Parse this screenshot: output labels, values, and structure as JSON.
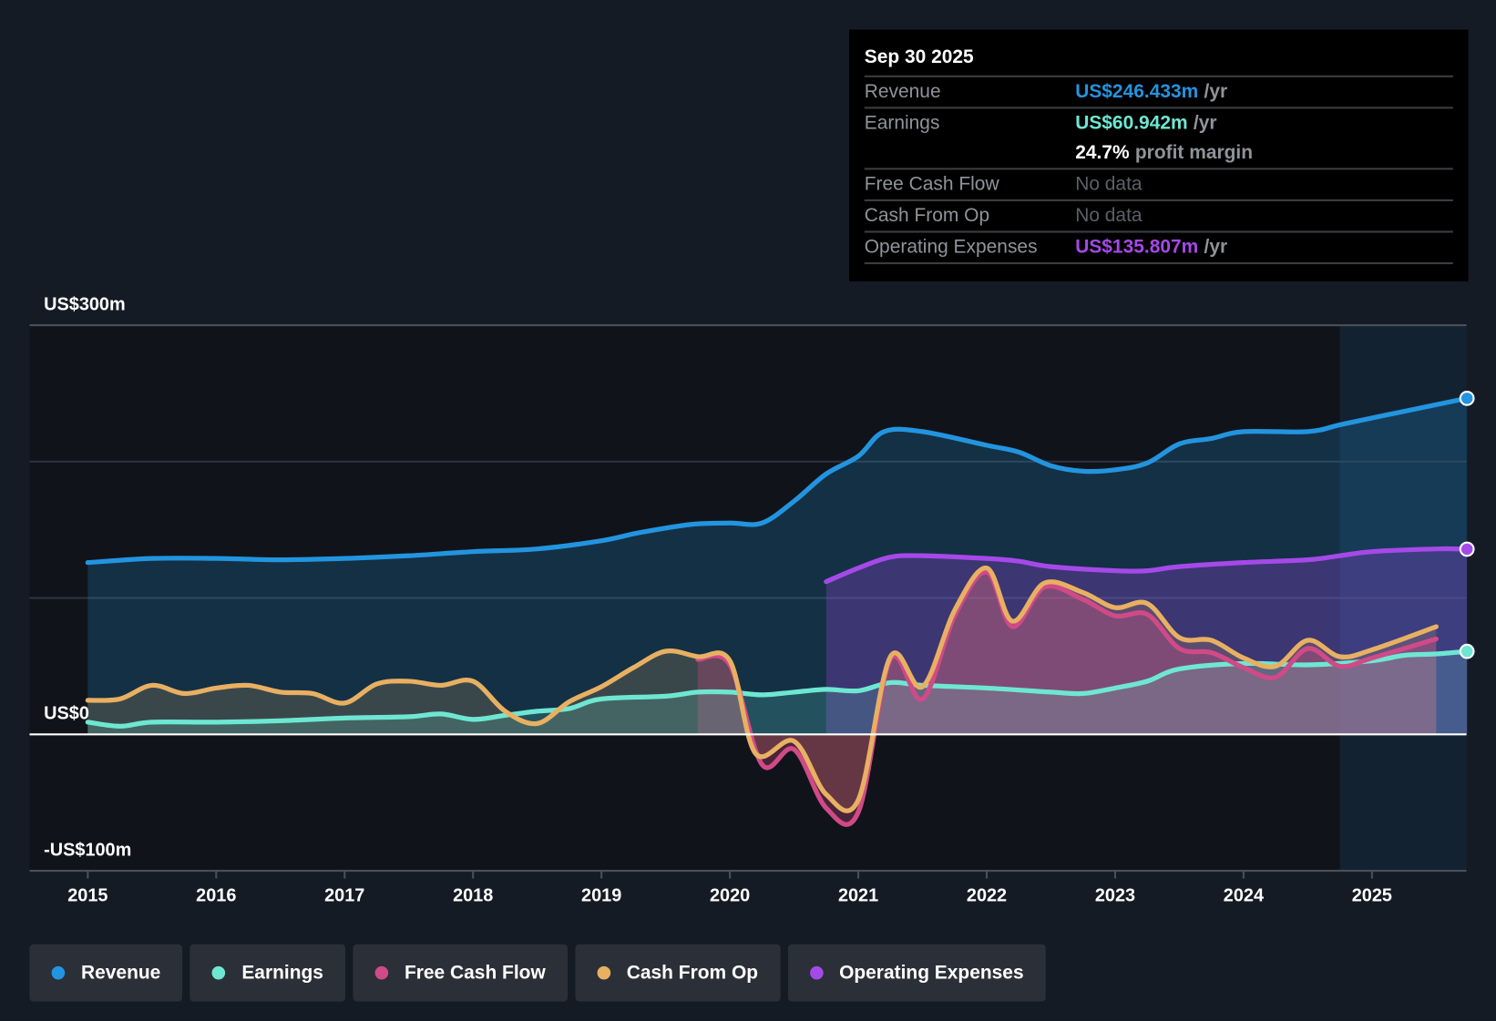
{
  "tooltip": {
    "date": "Sep 30 2025",
    "rows": [
      {
        "label": "Revenue",
        "value": "US$246.433m",
        "unit": "/yr"
      },
      {
        "label": "Earnings",
        "value": "US$60.942m",
        "unit": "/yr"
      },
      {
        "label": "",
        "value": "24.7%",
        "unit": "profit margin"
      },
      {
        "label": "Free Cash Flow",
        "value": "No data"
      },
      {
        "label": "Cash From Op",
        "value": "No data"
      },
      {
        "label": "Operating Expenses",
        "value": "US$135.807m",
        "unit": "/yr"
      }
    ]
  },
  "colors": {
    "revenue": "#2394df",
    "earnings": "#6ee7d2",
    "fcf": "#d04a87",
    "cfo": "#e8b062",
    "opex": "#a549e8",
    "background": "#151b24"
  },
  "chart_data": {
    "type": "line",
    "title": "",
    "xlabel": "",
    "ylabel": "",
    "ylim": [
      -100,
      300
    ],
    "xlim": [
      2014.55,
      2025.74
    ],
    "y_tick_labels": [
      "US$300m",
      "US$0",
      "-US$100m"
    ],
    "y_ticks": [
      300,
      0,
      -100
    ],
    "x_tick_labels": [
      "2015",
      "2016",
      "2017",
      "2018",
      "2019",
      "2020",
      "2021",
      "2022",
      "2023",
      "2024",
      "2025"
    ],
    "forecast_region_start": 2024.75,
    "grid": true,
    "legend": "bottom",
    "series": [
      {
        "name": "Revenue",
        "key": "revenue",
        "points": [
          [
            2015,
            126
          ],
          [
            2015.5,
            129
          ],
          [
            2016,
            129
          ],
          [
            2016.5,
            128
          ],
          [
            2017,
            129
          ],
          [
            2017.5,
            131
          ],
          [
            2018,
            134
          ],
          [
            2018.5,
            136
          ],
          [
            2019,
            142
          ],
          [
            2019.3,
            148
          ],
          [
            2019.7,
            154
          ],
          [
            2020,
            155
          ],
          [
            2020.25,
            155
          ],
          [
            2020.5,
            171
          ],
          [
            2020.75,
            191
          ],
          [
            2021,
            204
          ],
          [
            2021.2,
            222
          ],
          [
            2021.5,
            222
          ],
          [
            2022,
            212
          ],
          [
            2022.25,
            207
          ],
          [
            2022.5,
            197
          ],
          [
            2022.75,
            193
          ],
          [
            2023,
            194
          ],
          [
            2023.25,
            199
          ],
          [
            2023.5,
            213
          ],
          [
            2023.75,
            217
          ],
          [
            2024,
            222
          ],
          [
            2024.5,
            222
          ],
          [
            2024.75,
            227
          ],
          [
            2025,
            232
          ],
          [
            2025.74,
            246.4
          ]
        ]
      },
      {
        "name": "Earnings",
        "key": "earnings",
        "points": [
          [
            2015,
            9
          ],
          [
            2015.25,
            6
          ],
          [
            2015.5,
            9
          ],
          [
            2016,
            9
          ],
          [
            2016.5,
            10
          ],
          [
            2017,
            12
          ],
          [
            2017.5,
            13
          ],
          [
            2017.75,
            15
          ],
          [
            2018,
            11
          ],
          [
            2018.25,
            14
          ],
          [
            2018.5,
            17
          ],
          [
            2018.75,
            19
          ],
          [
            2019,
            26
          ],
          [
            2019.5,
            28
          ],
          [
            2019.75,
            31
          ],
          [
            2020,
            31
          ],
          [
            2020.25,
            29
          ],
          [
            2020.5,
            31
          ],
          [
            2020.75,
            33
          ],
          [
            2021,
            32
          ],
          [
            2021.25,
            38
          ],
          [
            2021.5,
            36
          ],
          [
            2022,
            34
          ],
          [
            2022.5,
            31
          ],
          [
            2022.75,
            30
          ],
          [
            2023,
            34
          ],
          [
            2023.25,
            39
          ],
          [
            2023.5,
            48
          ],
          [
            2024,
            52
          ],
          [
            2024.5,
            51
          ],
          [
            2025,
            54
          ],
          [
            2025.25,
            58
          ],
          [
            2025.5,
            59
          ],
          [
            2025.74,
            60.9
          ]
        ]
      },
      {
        "name": "Free Cash Flow",
        "key": "fcf",
        "points": [
          [
            2019.75,
            55
          ],
          [
            2020,
            51
          ],
          [
            2020.25,
            -22
          ],
          [
            2020.5,
            -11
          ],
          [
            2020.75,
            -54
          ],
          [
            2021,
            -57
          ],
          [
            2021.25,
            55
          ],
          [
            2021.5,
            26
          ],
          [
            2021.75,
            87
          ],
          [
            2022,
            119
          ],
          [
            2022.2,
            79
          ],
          [
            2022.45,
            108
          ],
          [
            2022.75,
            99
          ],
          [
            2023,
            87
          ],
          [
            2023.25,
            88
          ],
          [
            2023.5,
            63
          ],
          [
            2023.75,
            60
          ],
          [
            2024,
            49
          ],
          [
            2024.25,
            42
          ],
          [
            2024.5,
            63
          ],
          [
            2024.75,
            50
          ],
          [
            2025,
            56
          ],
          [
            2025.5,
            70
          ]
        ]
      },
      {
        "name": "Cash From Op",
        "key": "cfo",
        "points": [
          [
            2015,
            25
          ],
          [
            2015.25,
            26
          ],
          [
            2015.5,
            36
          ],
          [
            2015.75,
            30
          ],
          [
            2016,
            34
          ],
          [
            2016.25,
            36
          ],
          [
            2016.5,
            31
          ],
          [
            2016.75,
            30
          ],
          [
            2017,
            23
          ],
          [
            2017.25,
            37
          ],
          [
            2017.5,
            39
          ],
          [
            2017.75,
            36
          ],
          [
            2018,
            39
          ],
          [
            2018.25,
            17
          ],
          [
            2018.5,
            8
          ],
          [
            2018.75,
            24
          ],
          [
            2019,
            35
          ],
          [
            2019.25,
            49
          ],
          [
            2019.5,
            61
          ],
          [
            2019.75,
            57
          ],
          [
            2020,
            54
          ],
          [
            2020.2,
            -14
          ],
          [
            2020.5,
            -5
          ],
          [
            2020.75,
            -44
          ],
          [
            2021,
            -48
          ],
          [
            2021.25,
            57
          ],
          [
            2021.5,
            35
          ],
          [
            2021.75,
            91
          ],
          [
            2022,
            122
          ],
          [
            2022.2,
            83
          ],
          [
            2022.45,
            111
          ],
          [
            2022.75,
            104
          ],
          [
            2023,
            93
          ],
          [
            2023.25,
            96
          ],
          [
            2023.5,
            71
          ],
          [
            2023.75,
            69
          ],
          [
            2024,
            56
          ],
          [
            2024.25,
            50
          ],
          [
            2024.5,
            69
          ],
          [
            2024.75,
            57
          ],
          [
            2025,
            62
          ],
          [
            2025.5,
            79
          ]
        ]
      },
      {
        "name": "Operating Expenses",
        "key": "opex",
        "points": [
          [
            2020.75,
            112
          ],
          [
            2021,
            122
          ],
          [
            2021.25,
            130
          ],
          [
            2021.5,
            131
          ],
          [
            2022,
            129
          ],
          [
            2022.25,
            127
          ],
          [
            2022.5,
            123
          ],
          [
            2023,
            120
          ],
          [
            2023.25,
            120
          ],
          [
            2023.5,
            123
          ],
          [
            2024,
            126
          ],
          [
            2024.5,
            128
          ],
          [
            2024.75,
            131
          ],
          [
            2025,
            134
          ],
          [
            2025.5,
            136
          ],
          [
            2025.74,
            135.8
          ]
        ]
      }
    ]
  },
  "legend": [
    {
      "label": "Revenue",
      "key": "revenue"
    },
    {
      "label": "Earnings",
      "key": "earnings"
    },
    {
      "label": "Free Cash Flow",
      "key": "fcf"
    },
    {
      "label": "Cash From Op",
      "key": "cfo"
    },
    {
      "label": "Operating Expenses",
      "key": "opex"
    }
  ]
}
